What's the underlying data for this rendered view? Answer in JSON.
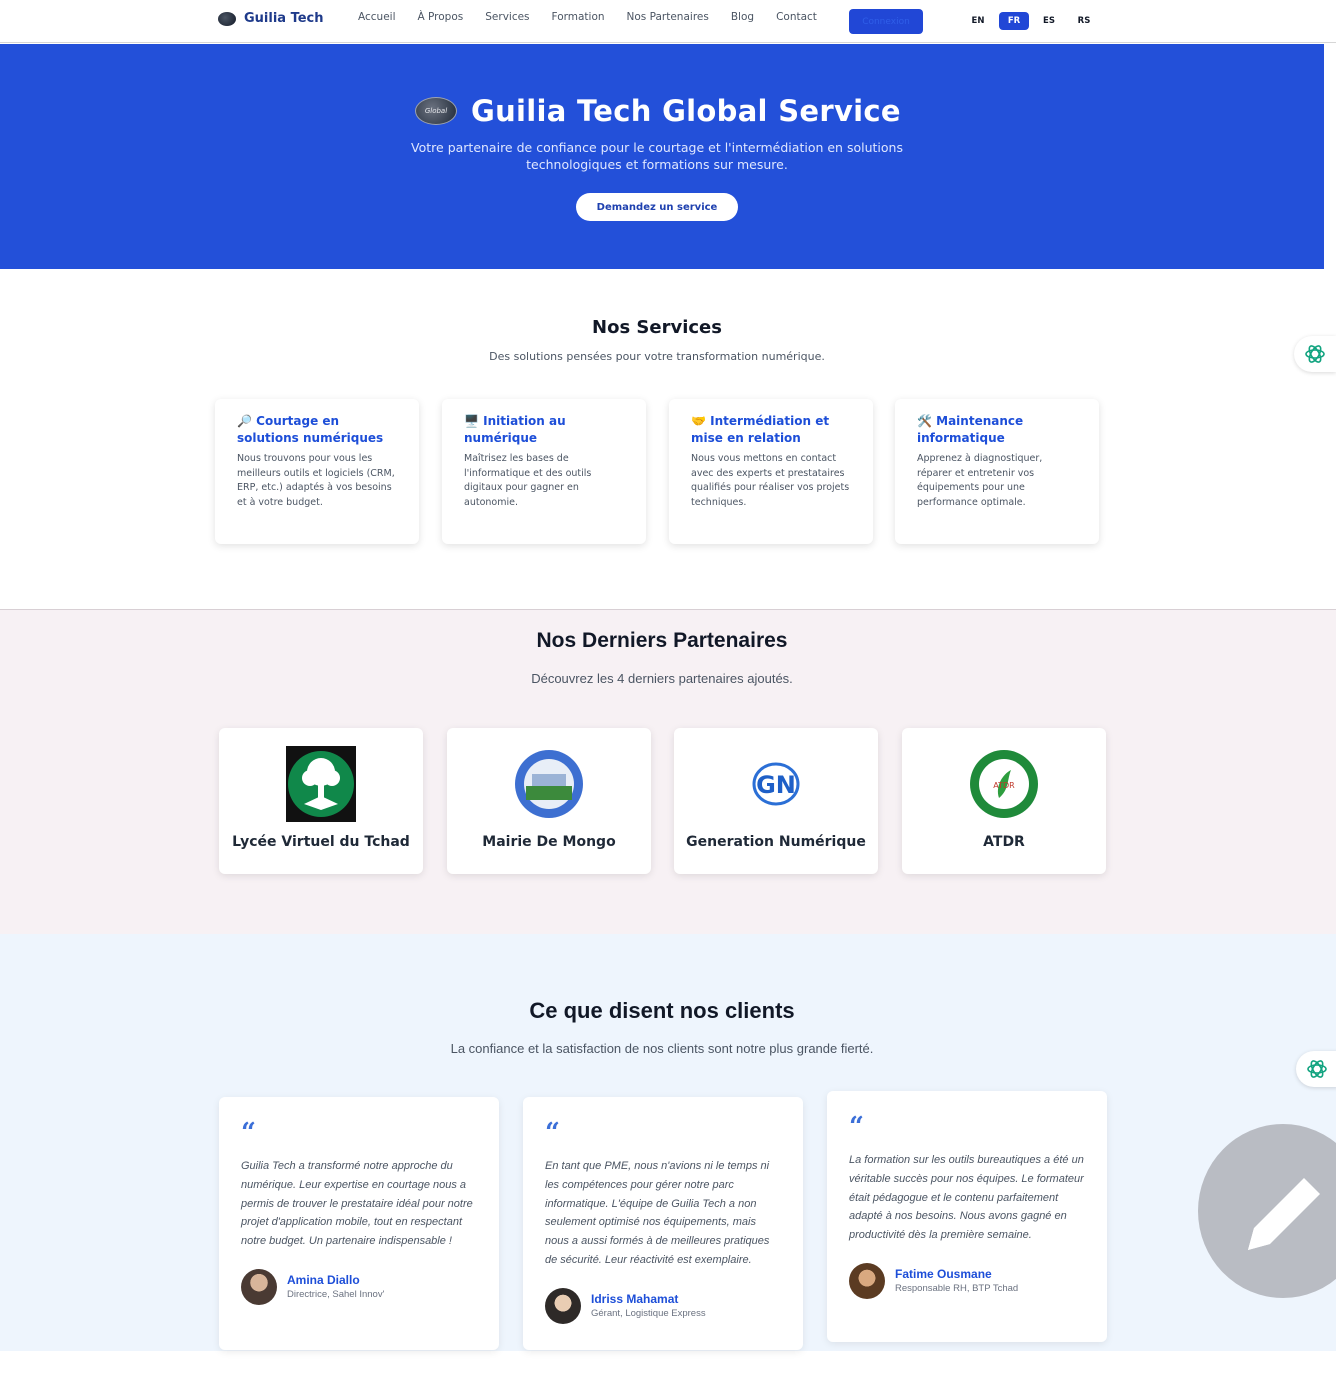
{
  "nav": {
    "brand": "Guilia Tech",
    "links": [
      "Accueil",
      "À Propos",
      "Services",
      "Formation",
      "Nos Partenaires",
      "Blog",
      "Contact"
    ],
    "button_label": "Connexion",
    "languages": [
      "EN",
      "FR",
      "ES",
      "RS"
    ],
    "active_language": "FR"
  },
  "hero": {
    "logo_text": "Global",
    "title": "Guilia Tech Global Service",
    "subtitle": "Votre partenaire de confiance pour le courtage et l'intermédiation en solutions technologiques et formations sur mesure.",
    "cta": "Demandez un service"
  },
  "services": {
    "title": "Nos Services",
    "subtitle": "Des solutions pensées pour votre transformation numérique.",
    "items": [
      {
        "icon": "🔎",
        "title": "Courtage en solutions numériques",
        "desc": "Nous trouvons pour vous les meilleurs outils et logiciels (CRM, ERP, etc.) adaptés à vos besoins et à votre budget."
      },
      {
        "icon": "🖥️",
        "title": "Initiation au numérique",
        "desc": "Maîtrisez les bases de l'informatique et des outils digitaux pour gagner en autonomie."
      },
      {
        "icon": "🤝",
        "title": "Intermédiation et mise en relation",
        "desc": "Nous vous mettons en contact avec des experts et prestataires qualifiés pour réaliser vos projets techniques."
      },
      {
        "icon": "🛠️",
        "title": "Maintenance informatique",
        "desc": "Apprenez à diagnostiquer, réparer et entretenir vos équipements pour une performance optimale."
      }
    ]
  },
  "partners": {
    "title": "Nos Derniers Partenaires",
    "subtitle": "Découvrez les 4 derniers partenaires ajoutés.",
    "items": [
      {
        "name": "Lycée Virtuel du Tchad",
        "logo": "tree-logo-icon"
      },
      {
        "name": "Mairie De Mongo",
        "logo": "round-seal-logo-icon"
      },
      {
        "name": "Generation Numérique",
        "logo": "gn-logo-icon",
        "logo_text": "GN"
      },
      {
        "name": "ATDR",
        "logo": "atdr-seal-logo-icon",
        "logo_text": "ATDR"
      }
    ]
  },
  "testimonials": {
    "title": "Ce que disent nos clients",
    "subtitle": "La confiance et la satisfaction de nos clients sont notre plus grande fierté.",
    "quote_mark": "“",
    "items": [
      {
        "text": "Guilia Tech a transformé notre approche du numérique. Leur expertise en courtage nous a permis de trouver le prestataire idéal pour notre projet d'application mobile, tout en respectant notre budget. Un partenaire indispensable !",
        "name": "Amina Diallo",
        "role": "Directrice, Sahel Innov'"
      },
      {
        "text": "En tant que PME, nous n'avions ni le temps ni les compétences pour gérer notre parc informatique. L'équipe de Guilia Tech a non seulement optimisé nos équipements, mais nous a aussi formés à de meilleures pratiques de sécurité. Leur réactivité est exemplaire.",
        "name": "Idriss Mahamat",
        "role": "Gérant, Logistique Express"
      },
      {
        "text": "La formation sur les outils bureautiques a été un véritable succès pour nos équipes. Le formateur était pédagogue et le contenu parfaitement adapté à nos besoins. Nous avons gagné en productivité dès la première semaine.",
        "name": "Fatime Ousmane",
        "role": "Responsable RH, BTP Tchad"
      }
    ]
  },
  "colors": {
    "primary": "#2350d9",
    "accent_text": "#1d4ed8",
    "partners_bg": "#f7f1f4",
    "testimonials_bg": "#eef5fd",
    "ai_icon": "#10a37f"
  }
}
